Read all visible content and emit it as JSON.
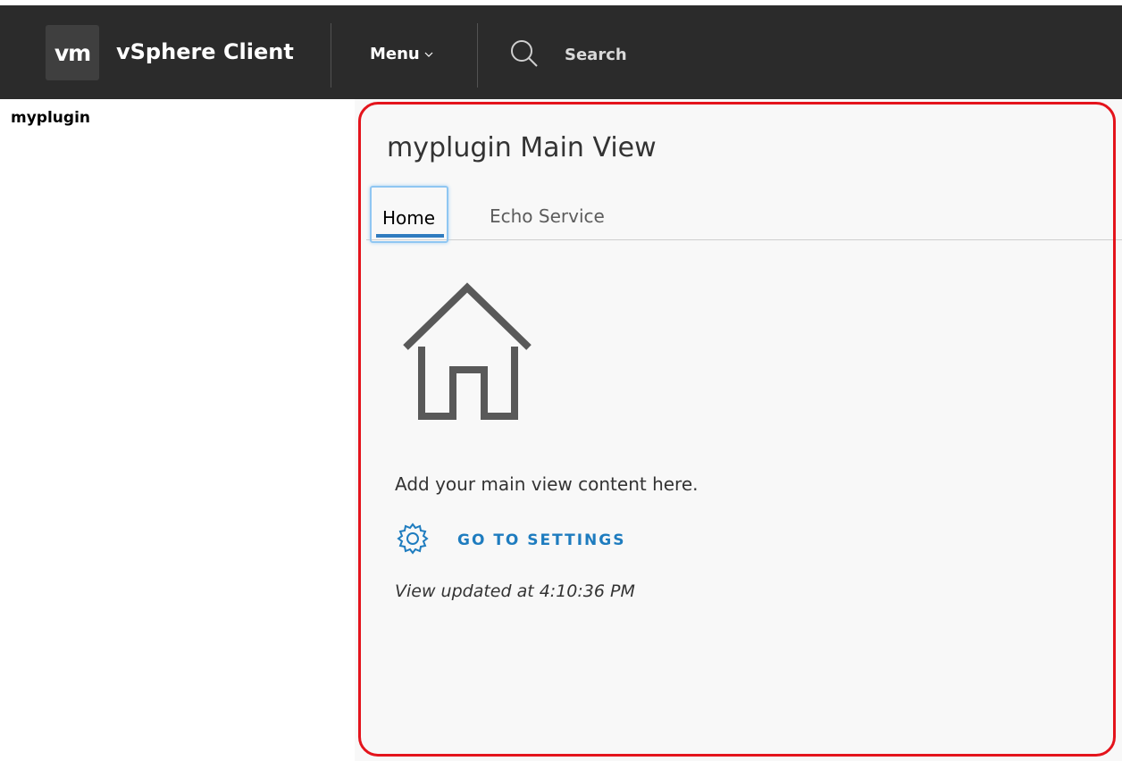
{
  "header": {
    "logo_text": "vm",
    "app_title": "vSphere Client",
    "menu_label": "Menu",
    "search_label": "Search",
    "background_color": "#2b2b2b"
  },
  "nav": {
    "title": "myplugin"
  },
  "main": {
    "title": "myplugin Main View",
    "tabs": [
      {
        "label": "Home",
        "selected": true
      },
      {
        "label": "Echo Service",
        "selected": false
      }
    ],
    "content_text": "Add your main view content here.",
    "settings_link_label": "GO TO SETTINGS",
    "updated_text": "View updated at 4:10:36 PM",
    "home_icon": "home-icon",
    "settings_icon": "gear-icon"
  },
  "colors": {
    "accent": "#1e7cbf",
    "tab_underline": "#2f7bbf",
    "highlight": "#e4141c"
  }
}
